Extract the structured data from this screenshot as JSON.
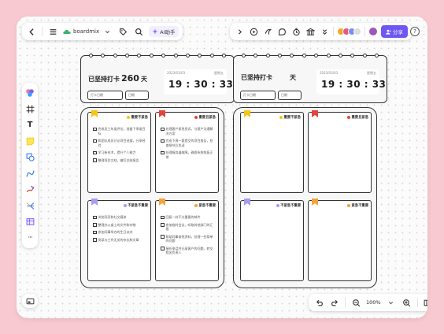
{
  "app": {
    "brand": "boardmix",
    "ai_label": "AI助手",
    "share_label": "分享",
    "zoom": "100%"
  },
  "board_left": {
    "title": "已坚持打卡",
    "days": "260",
    "unit": "天",
    "field1": "打卡日期",
    "field2": "日期",
    "clock_date": "2023/03/03",
    "clock_week": "星期五",
    "time": "19 : 30 : 33"
  },
  "board_right": {
    "title": "已坚持打卡",
    "days": "",
    "unit": "天",
    "field1": "打卡日期",
    "field2": "日期",
    "clock_date": "2023/03/03",
    "clock_week": "星期五",
    "time": "19 : 30 : 33"
  },
  "quadrants": {
    "labels": {
      "important_not_urgent": "重要不紧急",
      "important_urgent": "重要且紧急",
      "not_important_not_urgent": "不紧急不重要",
      "urgent_not_important": "紧急不重要"
    },
    "colors": {
      "yellow": "#f5c518",
      "red": "#e3443c",
      "purple": "#a79cf0",
      "orange": "#f2a33a"
    },
    "left_tasks": {
      "important_not_urgent": [
        "完成员工年度评估，准备下季度目标",
        "和团队成员讨论项目进展，分享经验",
        "学习新技术，提升个人能力",
        "整理项目文档，编写总结报告"
      ],
      "important_urgent": [
        "处理客户紧急投诉，与客户沟通解决方案",
        "完成下周一要提交的项目报告，检查细节后发送",
        "处理服务器故障，确保系统恢复正常"
      ],
      "not_important_not_urgent": [
        "浏览网页和社交媒体",
        "整理办公桌上的文件和杂物",
        "参加同事举办的生日派对",
        "阅读与工作无关的杂志和文章"
      ],
      "urgent_not_important": [
        "回复一封不太重要的邮件",
        "参加临时会议，听取其他部门的汇报",
        "帮助同事查找资料，处理一些简单的问题",
        "接听电话并记录客户的问题，转交相关负责人"
      ]
    }
  }
}
